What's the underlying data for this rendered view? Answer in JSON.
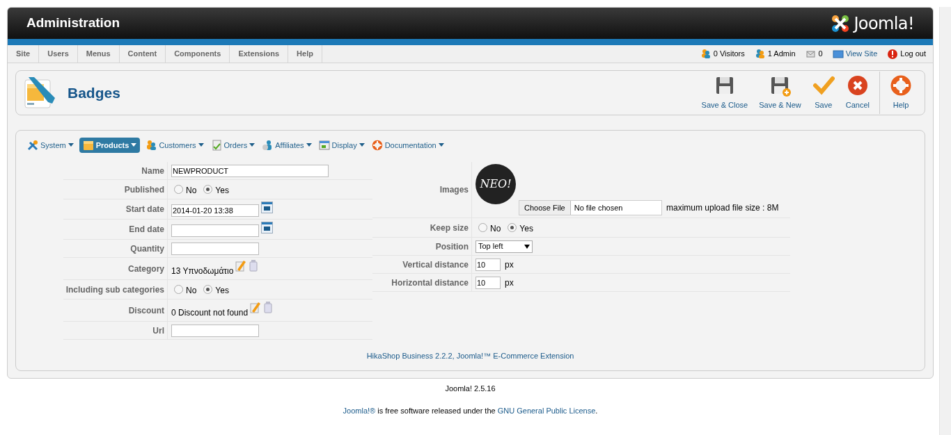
{
  "header": {
    "title": "Administration",
    "logo_text": "Joomla!"
  },
  "menu": [
    "Site",
    "Users",
    "Menus",
    "Content",
    "Components",
    "Extensions",
    "Help"
  ],
  "status": [
    {
      "kind": "visitors",
      "label": "0 Visitors"
    },
    {
      "kind": "admin",
      "label": "1 Admin"
    },
    {
      "kind": "messages",
      "label": "0"
    },
    {
      "kind": "viewsite",
      "label": "View Site"
    },
    {
      "kind": "logout",
      "label": "Log out"
    }
  ],
  "toolbar": {
    "title": "Badges",
    "buttons": [
      {
        "kind": "save-close",
        "label": "Save & Close"
      },
      {
        "kind": "save-new",
        "label": "Save & New"
      },
      {
        "kind": "save",
        "label": "Save"
      },
      {
        "kind": "cancel",
        "label": "Cancel"
      },
      {
        "kind": "help",
        "label": "Help"
      }
    ]
  },
  "tabs": [
    {
      "kind": "system",
      "label": "System",
      "selected": false
    },
    {
      "kind": "products",
      "label": "Products",
      "selected": true
    },
    {
      "kind": "customers",
      "label": "Customers",
      "selected": false
    },
    {
      "kind": "orders",
      "label": "Orders",
      "selected": false
    },
    {
      "kind": "affiliates",
      "label": "Affiliates",
      "selected": false
    },
    {
      "kind": "display",
      "label": "Display",
      "selected": false
    },
    {
      "kind": "documentation",
      "label": "Documentation",
      "selected": false
    }
  ],
  "form_left": [
    {
      "kind": "text",
      "label": "Name",
      "value": "NEWPRODUCT"
    },
    {
      "kind": "radio",
      "label": "Published",
      "options": [
        {
          "label": "No",
          "selected": false
        },
        {
          "label": "Yes",
          "selected": true
        }
      ]
    },
    {
      "kind": "date",
      "label": "Start date",
      "value": "2014-01-20 13:38"
    },
    {
      "kind": "date",
      "label": "End date"
    },
    {
      "kind": "text",
      "label": "Quantity"
    },
    {
      "kind": "picker",
      "label": "Category",
      "value": "13 Υπνοδωμάτιο"
    },
    {
      "kind": "radio",
      "label": "Including sub categories",
      "options": [
        {
          "label": "No",
          "selected": false
        },
        {
          "label": "Yes",
          "selected": true
        }
      ]
    },
    {
      "kind": "picker",
      "label": "Discount",
      "value": "0 Discount not found"
    },
    {
      "kind": "text",
      "label": "Url"
    }
  ],
  "form_right": [
    {
      "kind": "image",
      "label": "Images",
      "badge_text": "NEO!",
      "file_button": "Choose File",
      "file_status": "No file chosen",
      "note": "maximum upload file size : 8M"
    },
    {
      "kind": "radio",
      "label": "Keep size",
      "options": [
        {
          "label": "No",
          "selected": false
        },
        {
          "label": "Yes",
          "selected": true
        }
      ]
    },
    {
      "kind": "select",
      "label": "Position",
      "value": "Top left"
    },
    {
      "kind": "number",
      "label": "Vertical distance",
      "value": "10",
      "unit": "px"
    },
    {
      "kind": "number",
      "label": "Horizontal distance",
      "value": "10",
      "unit": "px"
    }
  ],
  "credit": "HikaShop Business 2.2.2, Joomla!™ E-Commerce Extension",
  "footer": {
    "version": "Joomla! 2.5.16",
    "license": [
      {
        "kind": "link",
        "text": "Joomla!®"
      },
      {
        "kind": "text",
        "text": " is free software released under the "
      },
      {
        "kind": "link",
        "text": "GNU General Public License"
      },
      {
        "kind": "text",
        "text": "."
      }
    ]
  }
}
